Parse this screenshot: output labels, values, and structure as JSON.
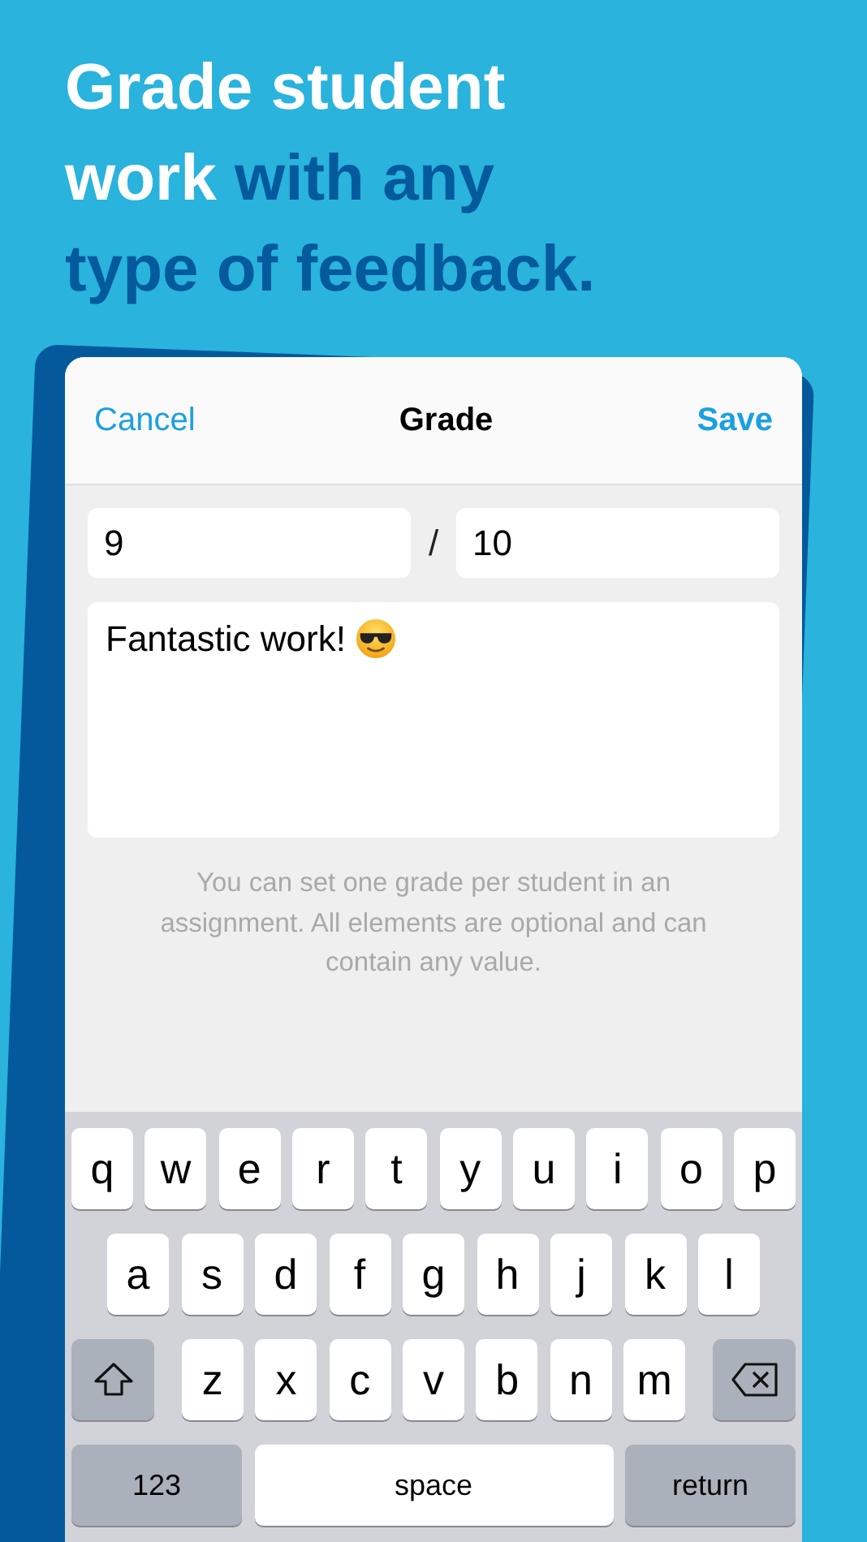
{
  "headline": [
    {
      "text": "Grade student work ",
      "highlight": false
    },
    {
      "text": "with any type of feedback.",
      "highlight": true
    }
  ],
  "nav": {
    "cancel": "Cancel",
    "title": "Grade",
    "save": "Save"
  },
  "grade": {
    "score": "9",
    "separator": "/",
    "max": "10"
  },
  "comment": {
    "value": "Fantastic work!"
  },
  "hint": "You can set one grade per student in an assignment. All elements are optional and can contain any value.",
  "keyboard": [
    [
      {
        "kind": "letter",
        "label": "q"
      },
      {
        "kind": "letter",
        "label": "w"
      },
      {
        "kind": "letter",
        "label": "e"
      },
      {
        "kind": "letter",
        "label": "r"
      },
      {
        "kind": "letter",
        "label": "t"
      },
      {
        "kind": "letter",
        "label": "y"
      },
      {
        "kind": "letter",
        "label": "u"
      },
      {
        "kind": "letter",
        "label": "i"
      },
      {
        "kind": "letter",
        "label": "o"
      },
      {
        "kind": "letter",
        "label": "p"
      }
    ],
    [
      {
        "kind": "letter",
        "label": "a"
      },
      {
        "kind": "letter",
        "label": "s"
      },
      {
        "kind": "letter",
        "label": "d"
      },
      {
        "kind": "letter",
        "label": "f"
      },
      {
        "kind": "letter",
        "label": "g"
      },
      {
        "kind": "letter",
        "label": "h"
      },
      {
        "kind": "letter",
        "label": "j"
      },
      {
        "kind": "letter",
        "label": "k"
      },
      {
        "kind": "letter",
        "label": "l"
      }
    ],
    [
      {
        "kind": "shift"
      },
      {
        "kind": "letter",
        "label": "z"
      },
      {
        "kind": "letter",
        "label": "x"
      },
      {
        "kind": "letter",
        "label": "c"
      },
      {
        "kind": "letter",
        "label": "v"
      },
      {
        "kind": "letter",
        "label": "b"
      },
      {
        "kind": "letter",
        "label": "n"
      },
      {
        "kind": "letter",
        "label": "m"
      },
      {
        "kind": "delete"
      }
    ],
    [
      {
        "kind": "mode",
        "label": "123"
      },
      {
        "kind": "space",
        "label": "space"
      },
      {
        "kind": "return",
        "label": "return"
      }
    ]
  ]
}
